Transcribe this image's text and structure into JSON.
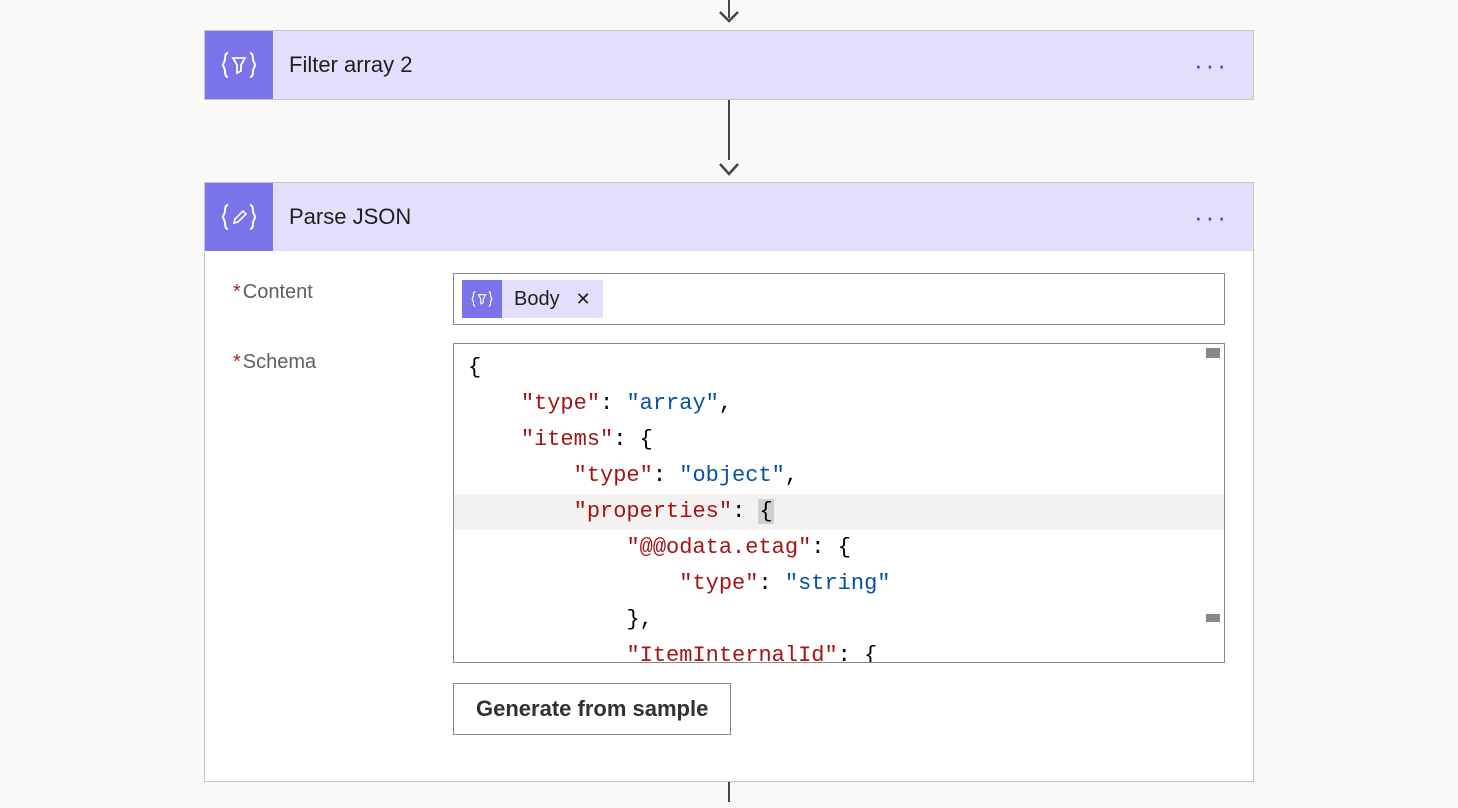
{
  "arrow_into": true,
  "filter_action": {
    "title": "Filter array 2",
    "icon": "filter-braces-icon",
    "menu": "···"
  },
  "parse_action": {
    "title": "Parse JSON",
    "icon": "edit-braces-icon",
    "menu": "···",
    "fields": {
      "content": {
        "label": "Content",
        "required": true,
        "token": {
          "icon": "filter-braces-icon",
          "label": "Body",
          "remove": "✕"
        }
      },
      "schema": {
        "label": "Schema",
        "required": true,
        "json_lines": [
          "{",
          "    \"type\": \"array\",",
          "    \"items\": {",
          "        \"type\": \"object\",",
          "        \"properties\": {",
          "            \"@@odata.etag\": {",
          "                \"type\": \"string\"",
          "            },",
          "            \"ItemInternalId\": {"
        ],
        "generate_button": "Generate from sample"
      }
    }
  }
}
